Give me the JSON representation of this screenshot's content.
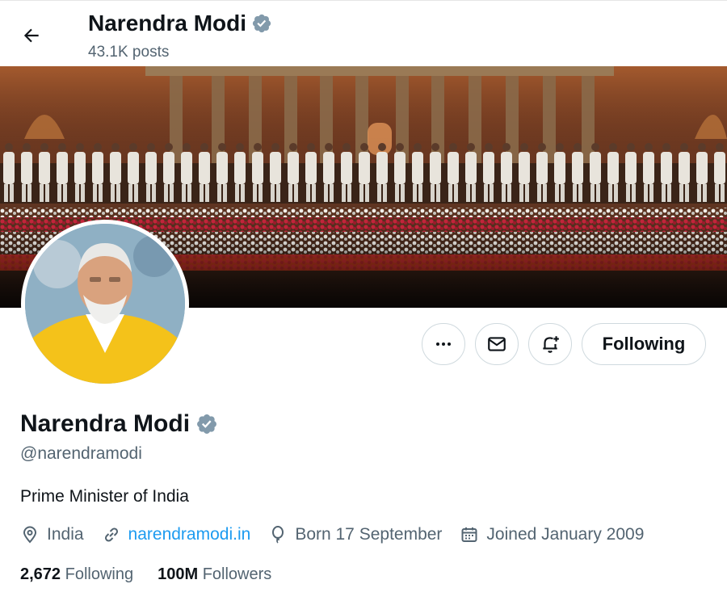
{
  "header": {
    "title": "Narendra Modi",
    "posts": "43.1K posts"
  },
  "profile": {
    "name": "Narendra Modi",
    "handle": "@narendramodi",
    "bio": "Prime Minister of India",
    "location": "India",
    "website": "narendramodi.in",
    "born": "Born 17 September",
    "joined": "Joined January 2009",
    "following_count": "2,672",
    "following_label": "Following",
    "followers_count": "100M",
    "followers_label": "Followers"
  },
  "actions": {
    "follow_state_label": "Following"
  },
  "icons": [
    "back-arrow-icon",
    "verified-badge-icon",
    "more-icon",
    "mail-icon",
    "notification-bell-icon",
    "location-icon",
    "link-icon",
    "balloon-icon",
    "calendar-icon"
  ],
  "colors": {
    "accent": "#1d9bf0",
    "verified": "#829aab",
    "text": "#0f1419",
    "muted": "#536471",
    "border": "#cfd9de"
  }
}
